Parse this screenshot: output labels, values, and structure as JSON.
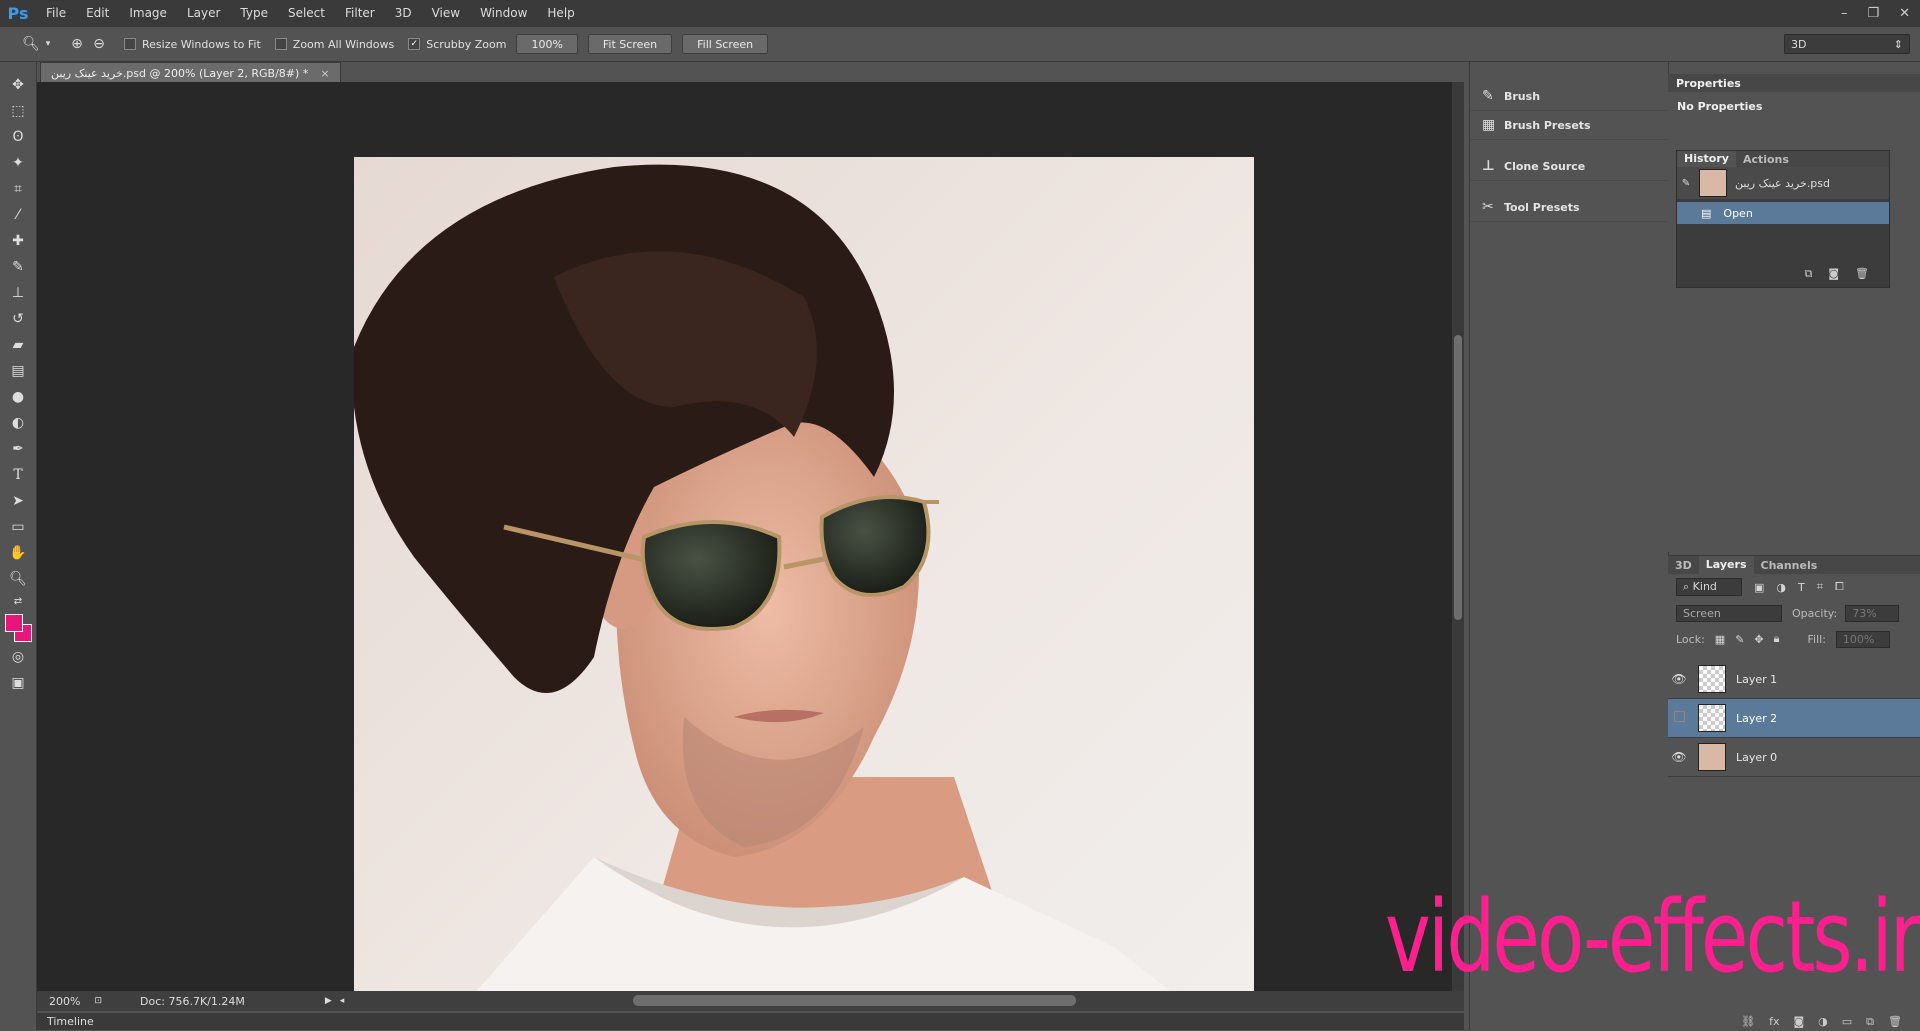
{
  "app": {
    "logo": "Ps"
  },
  "menu": [
    "File",
    "Edit",
    "Image",
    "Layer",
    "Type",
    "Select",
    "Filter",
    "3D",
    "View",
    "Window",
    "Help"
  ],
  "window_controls": [
    "–",
    "❐",
    "✕"
  ],
  "options": {
    "resize_windows": "Resize Windows to Fit",
    "zoom_all": "Zoom All Windows",
    "scrubby_zoom": "Scrubby Zoom",
    "zoom_100": "100%",
    "fit_screen": "Fit Screen",
    "fill_screen": "Fill Screen",
    "workspace": "3D"
  },
  "document": {
    "tab_title": "خرید عینک ریبن.psd @ 200% (Layer 2, RGB/8#) *",
    "zoom": "200%",
    "doc_info": "Doc: 756.7K/1.24M"
  },
  "timeline": "Timeline",
  "mid_panels": [
    {
      "label": "Brush",
      "icon": "brush-icon"
    },
    {
      "label": "Brush Presets",
      "icon": "brush-presets-icon"
    },
    {
      "label": "Clone Source",
      "icon": "clone-source-icon"
    },
    {
      "label": "Tool Presets",
      "icon": "tool-presets-icon"
    }
  ],
  "properties": {
    "title": "Properties",
    "empty": "No Properties"
  },
  "history": {
    "tabs": [
      "History",
      "Actions"
    ],
    "snapshot": "خرید عینک ریبن.psd",
    "states": [
      "Open"
    ]
  },
  "layers": {
    "tabs": [
      "3D",
      "Layers",
      "Channels"
    ],
    "filter_kind": "Kind",
    "blend_mode": "Screen",
    "opacity_label": "Opacity:",
    "opacity_value": "73%",
    "lock_label": "Lock:",
    "fill_label": "Fill:",
    "fill_value": "100%",
    "items": [
      {
        "name": "Layer 1",
        "visible": true,
        "selected": false
      },
      {
        "name": "Layer 2",
        "visible": false,
        "selected": true
      },
      {
        "name": "Layer 0",
        "visible": true,
        "selected": false
      }
    ]
  },
  "watermark": "video-effects.ir",
  "colors": {
    "foreground": "#e8167c",
    "background": "#e8167c",
    "accent": "#5b7a99",
    "watermark": "#ff1f8e"
  }
}
